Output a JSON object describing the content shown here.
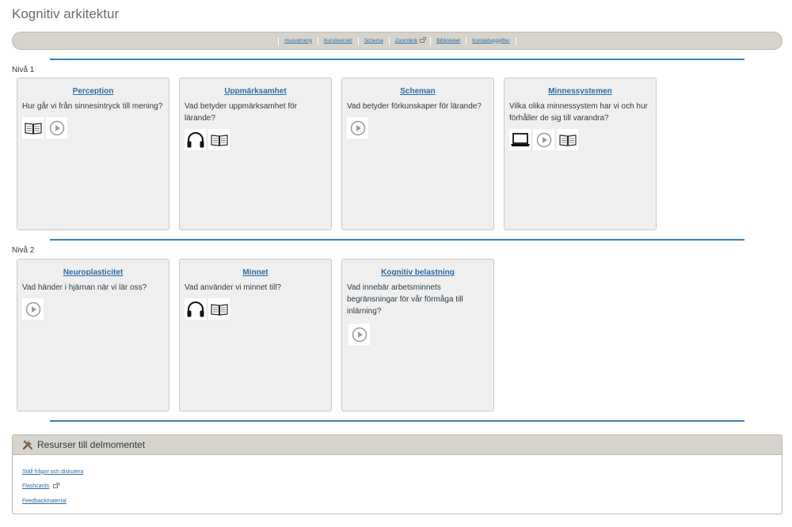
{
  "page": {
    "title": "Kognitiv arkitektur"
  },
  "nav": [
    {
      "label": "Huvudmeny",
      "external": false
    },
    {
      "label": "Kursöversikt",
      "external": false
    },
    {
      "label": "Schema",
      "external": false
    },
    {
      "label": "Zoomlänk",
      "external": true
    },
    {
      "label": "Biblioteket",
      "external": false
    },
    {
      "label": "Kontaktuppgifter",
      "external": false
    }
  ],
  "levels": [
    {
      "label": "Nivå 1",
      "cards": [
        {
          "title": "Perception",
          "description": "Hur går vi från sinnesintryck till mening?",
          "icons": [
            "book-icon",
            "play-icon"
          ]
        },
        {
          "title": "Uppmärksamhet",
          "description": "Vad betyder uppmärksamhet för lärande?",
          "icons": [
            "headphones-icon",
            "book-icon"
          ]
        },
        {
          "title": "Scheman",
          "description": "Vad betyder förkunskaper för lärande?",
          "icons": [
            "play-icon"
          ]
        },
        {
          "title": "Minnessystemen",
          "description": "Vilka olika minnessystem har vi och hur förhåller de sig till varandra?",
          "icons": [
            "laptop-icon",
            "play-icon",
            "book-icon"
          ]
        }
      ]
    },
    {
      "label": "Nivå 2",
      "cards": [
        {
          "title": "Neuroplasticitet",
          "description": "Vad händer i hjärnan när vi lär oss?",
          "icons": [
            "play-icon"
          ]
        },
        {
          "title": "Minnet ",
          "description": "Vad använder vi minnet till?",
          "icons": [
            "headphones-icon",
            "book-icon"
          ]
        },
        {
          "title": "Kognitiv belastning",
          "description": "Vad innebär arbetsminnets begränsningar för vår förmåga till inlärning?",
          "icons": [
            "play-icon"
          ]
        }
      ]
    }
  ],
  "resources": {
    "title": "Resurser till delmomentet",
    "icon": "tools-icon",
    "links": [
      {
        "label": "Ställ frågor och diskutera",
        "external": false
      },
      {
        "label": "Flashcards",
        "external": true
      },
      {
        "label": "Feedbackmaterial",
        "external": false
      }
    ]
  },
  "colors": {
    "link": "#2b6ca3",
    "divider": "#3b7fb5",
    "card_bg": "#efefef",
    "bar_bg": "#d6d3cc"
  }
}
